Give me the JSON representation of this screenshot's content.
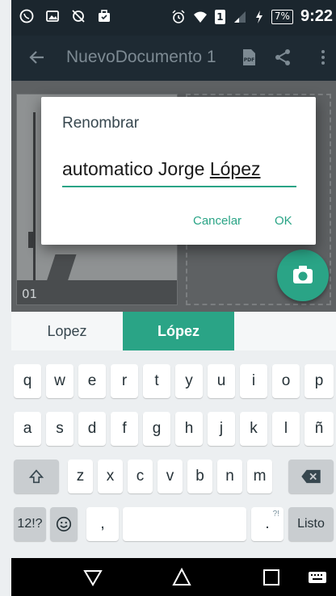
{
  "status_bar": {
    "left_icons": [
      "whatsapp-icon",
      "gallery-icon",
      "no-sync-icon",
      "briefcase-icon"
    ],
    "right_icons": [
      "alarm-icon",
      "wifi-icon",
      "sim-icon",
      "signal-icon",
      "charging-icon"
    ],
    "sim_label": "1",
    "battery": "7%",
    "time": "9:22"
  },
  "app_bar": {
    "title": "NuevoDocumento 1",
    "icons": [
      "back-arrow-icon",
      "pdf-icon",
      "share-icon",
      "more-vert-icon"
    ]
  },
  "document": {
    "page_number": "01",
    "fab_icon": "camera-icon"
  },
  "dialog": {
    "title": "Renombrar",
    "input_value_plain": "automatico Jorge ",
    "input_value_underlined": "López",
    "cancel_label": "Cancelar",
    "ok_label": "OK"
  },
  "keyboard": {
    "suggestions": [
      "Lopez",
      "López",
      ""
    ],
    "row1": [
      "q",
      "w",
      "e",
      "r",
      "t",
      "y",
      "u",
      "i",
      "o",
      "p"
    ],
    "row2": [
      "a",
      "s",
      "d",
      "f",
      "g",
      "h",
      "j",
      "k",
      "l",
      "ñ"
    ],
    "row3": [
      "z",
      "x",
      "c",
      "v",
      "b",
      "n",
      "m"
    ],
    "symbols_label": "12!?",
    "comma_label": ",",
    "period_label": ".",
    "period_hint": "?!",
    "done_label": "Listo",
    "icons": [
      "shift-icon",
      "backspace-icon",
      "emoji-icon"
    ]
  },
  "nav_bar": {
    "icons": [
      "back-nav-icon",
      "home-nav-icon",
      "recents-nav-icon",
      "keyboard-switch-icon"
    ]
  }
}
